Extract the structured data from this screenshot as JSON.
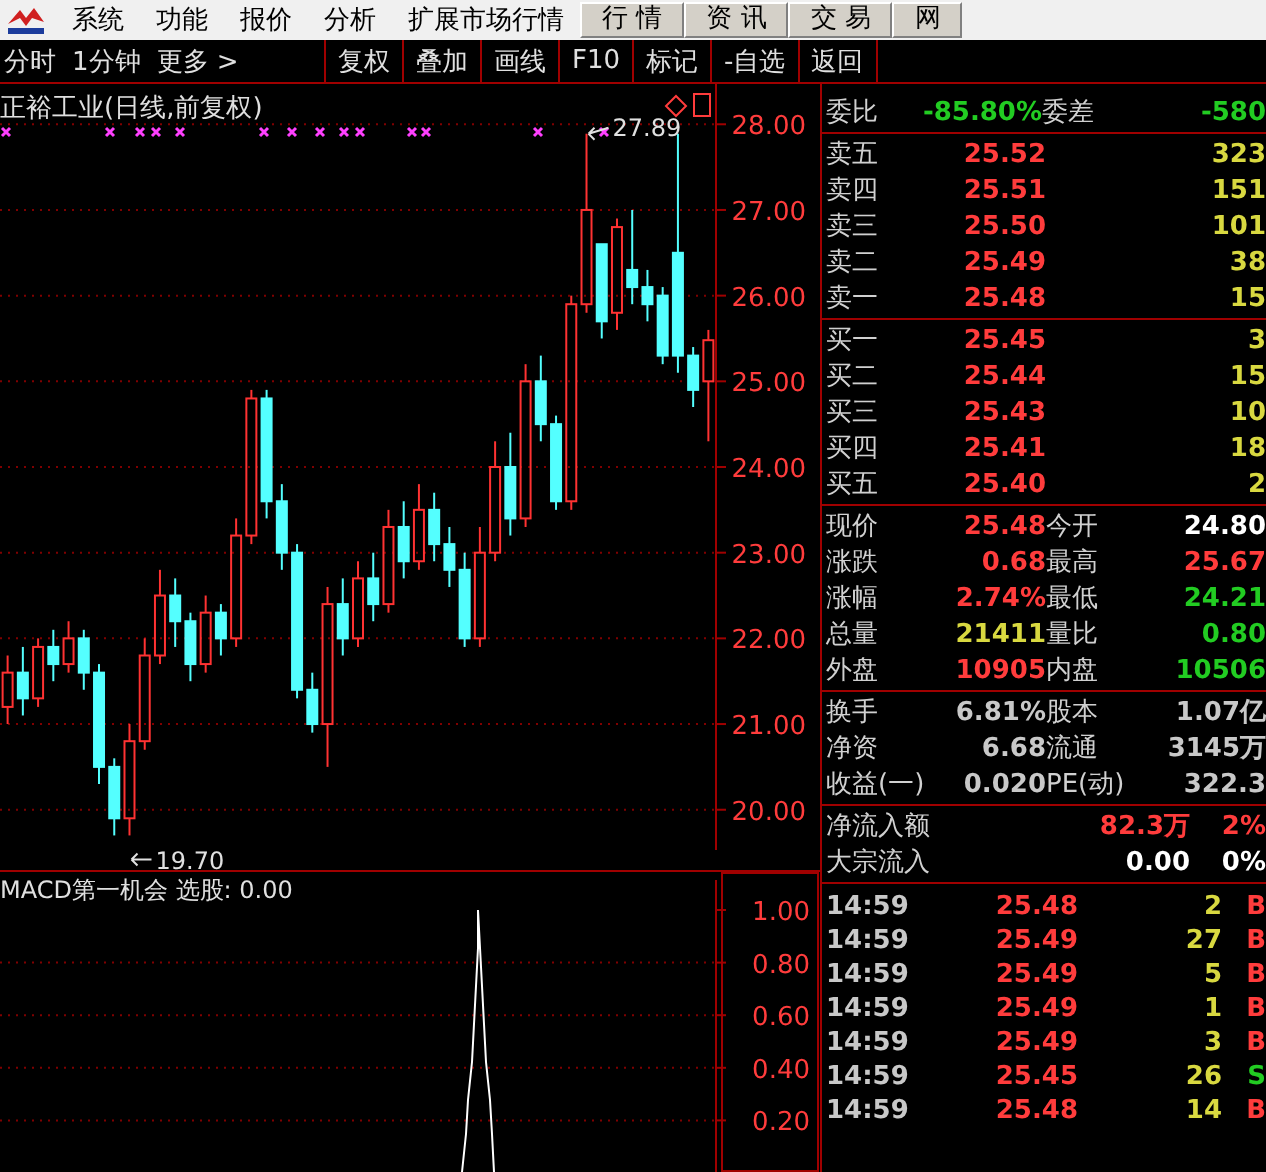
{
  "menu": [
    {
      "label": "系统"
    },
    {
      "label": "功能"
    },
    {
      "label": "报价"
    },
    {
      "label": "分析"
    },
    {
      "label": "扩展市场行情"
    }
  ],
  "tabs": [
    {
      "label": "行 情"
    },
    {
      "label": "资 讯"
    },
    {
      "label": "交 易"
    },
    {
      "label": "网"
    }
  ],
  "toolbar": {
    "periods": [
      "分时",
      "1分钟",
      "更多 >"
    ],
    "buttons": [
      "复权",
      "叠加",
      "画线",
      "F10",
      "标记",
      "-自选",
      "返回"
    ]
  },
  "chart": {
    "chart_data": {
      "type": "candlestick",
      "grid": true,
      "ylim": [
        19.53,
        28.47
      ],
      "yticks": [
        {
          "value": 28,
          "label": "28.00"
        },
        {
          "value": 27,
          "label": "27.00"
        },
        {
          "value": 26,
          "label": "26.00"
        },
        {
          "value": 25,
          "label": "25.00"
        },
        {
          "value": 24,
          "label": "24.00"
        },
        {
          "value": 23,
          "label": "23.00"
        },
        {
          "value": 22,
          "label": "22.00"
        },
        {
          "value": 21,
          "label": "21.00"
        },
        {
          "value": 20,
          "label": "20.00"
        }
      ],
      "ohlc": [
        [
          21.2,
          21.8,
          21.0,
          21.6
        ],
        [
          21.6,
          21.9,
          21.1,
          21.3
        ],
        [
          21.3,
          22.0,
          21.2,
          21.9
        ],
        [
          21.9,
          22.1,
          21.5,
          21.7
        ],
        [
          21.7,
          22.2,
          21.6,
          22.0
        ],
        [
          22.0,
          22.1,
          21.4,
          21.6
        ],
        [
          21.6,
          21.7,
          20.3,
          20.5
        ],
        [
          20.5,
          20.6,
          19.7,
          19.9
        ],
        [
          19.9,
          21.0,
          19.7,
          20.8
        ],
        [
          20.8,
          22.0,
          20.7,
          21.8
        ],
        [
          21.8,
          22.8,
          21.7,
          22.5
        ],
        [
          22.5,
          22.7,
          21.9,
          22.2
        ],
        [
          22.2,
          22.3,
          21.5,
          21.7
        ],
        [
          21.7,
          22.5,
          21.6,
          22.3
        ],
        [
          22.3,
          22.4,
          21.8,
          22.0
        ],
        [
          22.0,
          23.4,
          21.9,
          23.2
        ],
        [
          23.2,
          24.9,
          23.1,
          24.8
        ],
        [
          24.8,
          24.9,
          23.4,
          23.6
        ],
        [
          23.6,
          23.8,
          22.8,
          23.0
        ],
        [
          23.0,
          23.1,
          21.3,
          21.4
        ],
        [
          21.4,
          21.6,
          20.9,
          21.0
        ],
        [
          21.0,
          22.6,
          20.5,
          22.4
        ],
        [
          22.4,
          22.7,
          21.8,
          22.0
        ],
        [
          22.0,
          22.9,
          21.9,
          22.7
        ],
        [
          22.7,
          23.0,
          22.2,
          22.4
        ],
        [
          22.4,
          23.5,
          22.3,
          23.3
        ],
        [
          23.3,
          23.6,
          22.7,
          22.9
        ],
        [
          22.9,
          23.8,
          22.8,
          23.5
        ],
        [
          23.5,
          23.7,
          22.9,
          23.1
        ],
        [
          23.1,
          23.3,
          22.6,
          22.8
        ],
        [
          22.8,
          23.0,
          21.9,
          22.0
        ],
        [
          22.0,
          23.3,
          21.9,
          23.0
        ],
        [
          23.0,
          24.3,
          22.9,
          24.0
        ],
        [
          24.0,
          24.4,
          23.2,
          23.4
        ],
        [
          23.4,
          25.2,
          23.3,
          25.0
        ],
        [
          25.0,
          25.3,
          24.3,
          24.5
        ],
        [
          24.5,
          24.6,
          23.5,
          23.6
        ],
        [
          23.6,
          26.0,
          23.5,
          25.9
        ],
        [
          25.9,
          27.89,
          25.8,
          27.0
        ],
        [
          26.6,
          26.6,
          25.5,
          25.7
        ],
        [
          25.8,
          26.9,
          25.6,
          26.8
        ],
        [
          26.3,
          27.0,
          25.9,
          26.1
        ],
        [
          26.1,
          26.3,
          25.7,
          25.9
        ],
        [
          26.0,
          26.1,
          25.2,
          25.3
        ],
        [
          26.5,
          27.89,
          25.1,
          25.3
        ],
        [
          25.3,
          25.4,
          24.7,
          24.9
        ],
        [
          25.0,
          25.6,
          24.3,
          25.48
        ]
      ]
    },
    "title": "正裕工业(日线,前复权)",
    "high_label": "27.89",
    "low_label": "19.70"
  },
  "indicator": {
    "title": "MACD第一机会 选股: 0.00",
    "axis": [
      "1.00",
      "0.80",
      "0.60",
      "0.40",
      "0.20"
    ]
  },
  "quote": {
    "ratio": {
      "label": "委比",
      "value": "-85.80%",
      "label2": "委差",
      "value2": "-580"
    },
    "asks": [
      {
        "label": "卖五",
        "price": "25.52",
        "volume": "323"
      },
      {
        "label": "卖四",
        "price": "25.51",
        "volume": "151"
      },
      {
        "label": "卖三",
        "price": "25.50",
        "volume": "101"
      },
      {
        "label": "卖二",
        "price": "25.49",
        "volume": "38"
      },
      {
        "label": "卖一",
        "price": "25.48",
        "volume": "15"
      }
    ],
    "bids": [
      {
        "label": "买一",
        "price": "25.45",
        "volume": "3"
      },
      {
        "label": "买二",
        "price": "25.44",
        "volume": "15"
      },
      {
        "label": "买三",
        "price": "25.43",
        "volume": "10"
      },
      {
        "label": "买四",
        "price": "25.41",
        "volume": "18"
      },
      {
        "label": "买五",
        "price": "25.40",
        "volume": "2"
      }
    ],
    "stats": [
      {
        "label": "现价",
        "value": "25.48",
        "color": "#ff3c3c"
      },
      {
        "label": "今开",
        "value": "24.80",
        "color": "#ffffff"
      },
      {
        "label": "涨跌",
        "value": "0.68",
        "color": "#ff3c3c"
      },
      {
        "label": "最高",
        "value": "25.67",
        "color": "#ff3c3c"
      },
      {
        "label": "涨幅",
        "value": "2.74%",
        "color": "#ff3c3c"
      },
      {
        "label": "最低",
        "value": "24.21",
        "color": "#22cc22"
      },
      {
        "label": "总量",
        "value": "21411",
        "color": "#d8d840"
      },
      {
        "label": "量比",
        "value": "0.80",
        "color": "#22cc22"
      },
      {
        "label": "外盘",
        "value": "10905",
        "color": "#ff3c3c"
      },
      {
        "label": "内盘",
        "value": "10506",
        "color": "#22cc22"
      }
    ],
    "finance": [
      {
        "label": "换手",
        "value": "6.81%",
        "label2": "股本",
        "value2": "1.07亿"
      },
      {
        "label": "净资",
        "value": "6.68",
        "label2": "流通",
        "value2": "3145万"
      },
      {
        "label": "收益(一)",
        "value": "0.020",
        "label2": "PE(动)",
        "value2": "322.3"
      }
    ],
    "flows": [
      {
        "label": "净流入额",
        "value": "82.3万",
        "percent": "2%",
        "color": "#ff3c3c"
      },
      {
        "label": "大宗流入",
        "value": "0.00",
        "percent": "0%",
        "color": "#ffffff"
      }
    ],
    "ticks": [
      {
        "time": "14:59",
        "price": "25.48",
        "volume": "2",
        "side": "B",
        "color": "#ff3c3c"
      },
      {
        "time": "14:59",
        "price": "25.49",
        "volume": "27",
        "side": "B",
        "color": "#ff3c3c"
      },
      {
        "time": "14:59",
        "price": "25.49",
        "volume": "5",
        "side": "B",
        "color": "#ff3c3c"
      },
      {
        "time": "14:59",
        "price": "25.49",
        "volume": "1",
        "side": "B",
        "color": "#ff3c3c"
      },
      {
        "time": "14:59",
        "price": "25.49",
        "volume": "3",
        "side": "B",
        "color": "#ff3c3c"
      },
      {
        "time": "14:59",
        "price": "25.45",
        "volume": "26",
        "side": "S",
        "color": "#22cc22"
      },
      {
        "time": "14:59",
        "price": "25.48",
        "volume": "14",
        "side": "B",
        "color": "#ff3c3c"
      }
    ]
  }
}
